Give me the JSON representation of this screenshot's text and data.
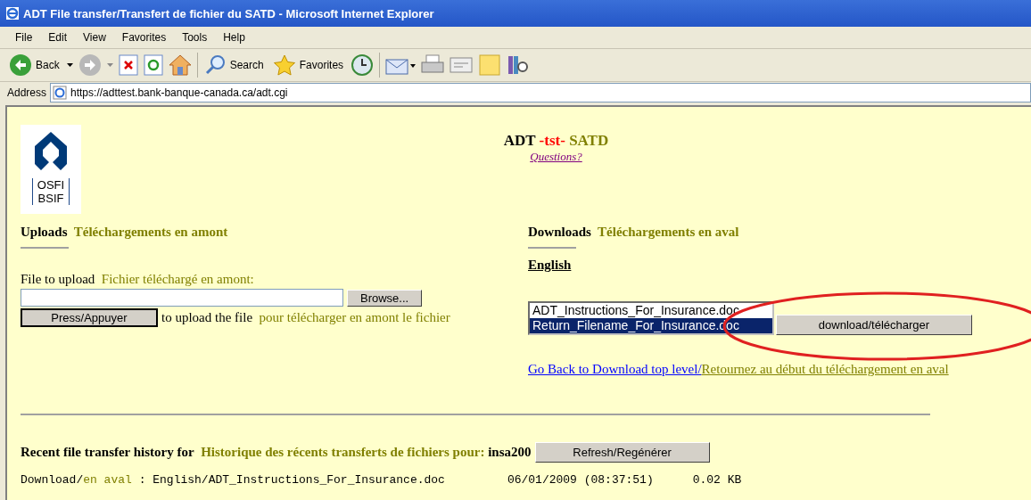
{
  "window": {
    "title": "ADT File transfer/Transfert de fichier du SATD - Microsoft Internet Explorer"
  },
  "menu": [
    "File",
    "Edit",
    "View",
    "Favorites",
    "Tools",
    "Help"
  ],
  "toolbar": {
    "back": "Back",
    "search": "Search",
    "favorites": "Favorites"
  },
  "address": {
    "label": "Address",
    "url": "https://adttest.bank-banque-canada.ca/adt.cgi"
  },
  "logo": {
    "line_1": "OSFI",
    "line_2": "BSIF"
  },
  "heading": {
    "name": "ADT",
    "env": "-tst-",
    "name_fr": "SATD",
    "questions_link": "Questions?"
  },
  "uploads": {
    "heading": "Uploads",
    "heading_fr": "Téléchargements en amont",
    "field_label": "File to upload",
    "field_label_fr": "Fichier téléchargé en amont:",
    "browse_button": "Browse...",
    "submit_button": "Press/Appuyer",
    "hint": "to upload the file",
    "hint_fr": "pour télécharger en amont le fichier"
  },
  "downloads": {
    "heading": "Downloads",
    "heading_fr": "Téléchargements en aval",
    "folder_link": "English",
    "files": [
      {
        "name": "ADT_Instructions_For_Insurance.doc",
        "selected": false
      },
      {
        "name": "Return_Filename_For_Insurance.doc",
        "selected": true
      }
    ],
    "download_button": "download/télécharger",
    "back_link": "Go Back to Download top level/",
    "back_link_fr": "Retournez au début du téléchargement en aval"
  },
  "history": {
    "label": "Recent file transfer history for",
    "label_fr": "Historique des récents transferts de fichiers pour:",
    "user": "insa200",
    "refresh_button": "Refresh/Regénérer",
    "entries": [
      {
        "direction": "Download/",
        "direction_fr": "en aval",
        "path": " : English/ADT_Instructions_For_Insurance.doc",
        "date": "06/01/2009 (08:37:51)",
        "size": "0.02 KB"
      }
    ]
  }
}
